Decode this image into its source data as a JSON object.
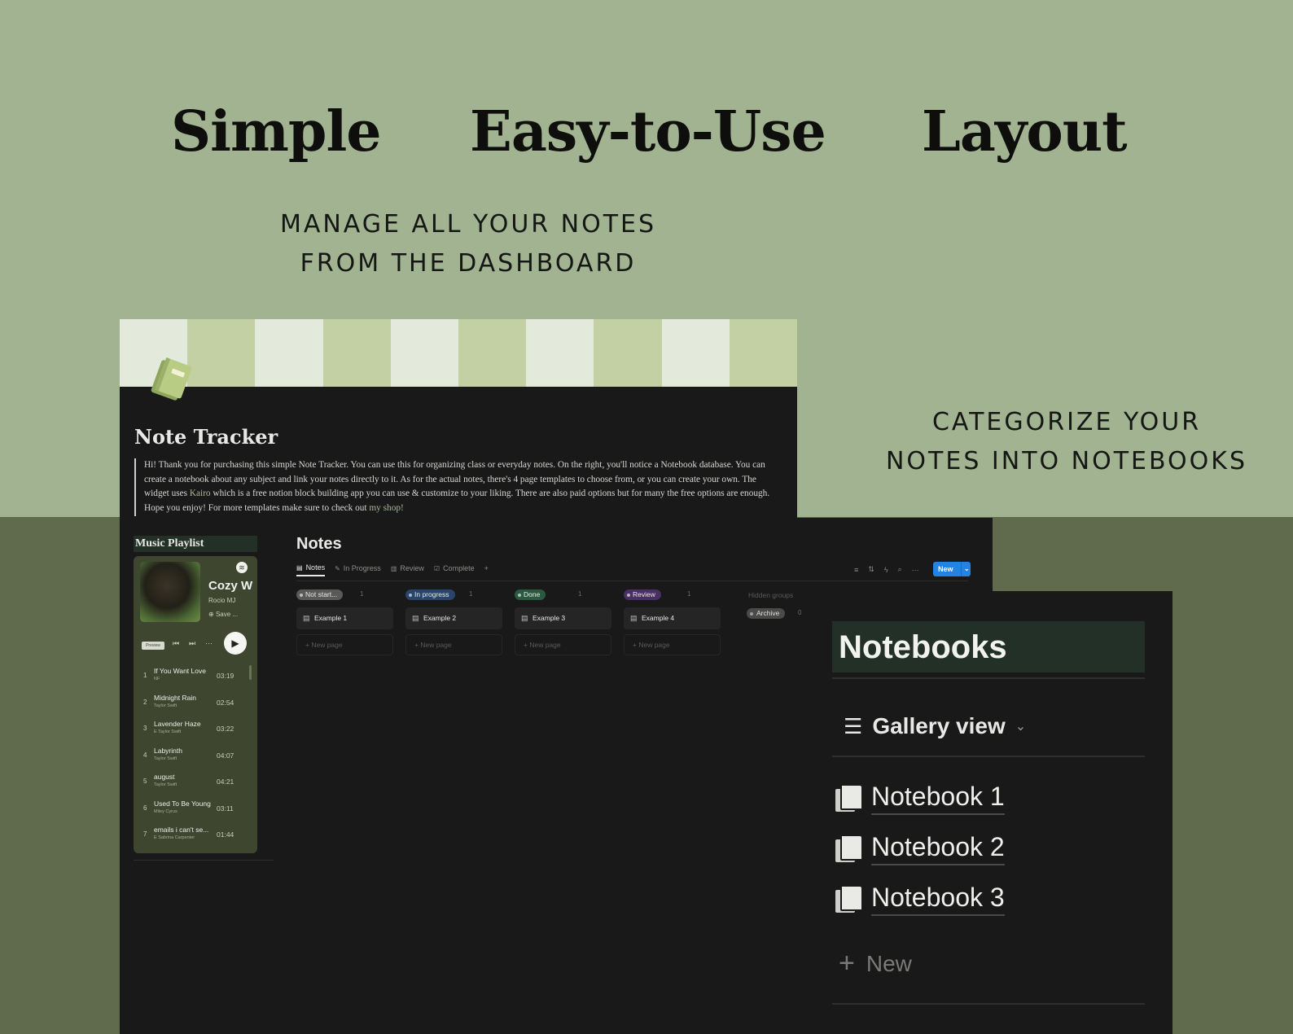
{
  "headlines": [
    "Simple",
    "Easy-to-Use",
    "Layout"
  ],
  "subtitles": {
    "dashboard": [
      "MANAGE ALL YOUR NOTES",
      "FROM THE DASHBOARD"
    ],
    "notebooks": [
      "CATEGORIZE YOUR",
      "NOTES INTO NOTEBOOKS"
    ]
  },
  "colors": {
    "background_top": "#a1b390",
    "background_bottom": "#606a4d",
    "app_background": "#191919",
    "heading_highlight": "#223027",
    "new_button": "#2383e2"
  },
  "page": {
    "title": "Note Tracker",
    "icon": "notebook-icon",
    "intro": {
      "before_kairo": "Hi! Thank you for purchasing this simple Note Tracker. You can use this for organizing class or everyday notes. On the right, you'll notice a Notebook database. You can create a notebook about any subject and link your notes directly to it. As for the actual notes, there's 4 page templates to choose from, or you can create your own. The widget uses ",
      "kairo_link": "Kairo",
      "after_kairo": " which is a free notion block building app you can use & customize to your liking. There are also paid options but for many the free options are enough. Hope you enjoy! For more templates make sure to check out ",
      "shop_link": "my shop!"
    }
  },
  "playlist": {
    "header": "Music Playlist",
    "album_title": "Cozy W",
    "artist": "Rocio MJ",
    "save_label": "Save ...",
    "preview_label": "Preview",
    "controls": {
      "prev": "⏮",
      "next": "⏭",
      "more": "···",
      "play": "▶"
    },
    "tracks": [
      {
        "num": "1",
        "name": "If You Want Love",
        "artist": "NF",
        "time": "03:19"
      },
      {
        "num": "2",
        "name": "Midnight Rain",
        "artist": "Taylor Swift",
        "time": "02:54"
      },
      {
        "num": "3",
        "name": "Lavender Haze",
        "artist": "E Taylor Swift",
        "time": "03:22"
      },
      {
        "num": "4",
        "name": "Labyrinth",
        "artist": "Taylor Swift",
        "time": "04:07"
      },
      {
        "num": "5",
        "name": "august",
        "artist": "Taylor Swift",
        "time": "04:21"
      },
      {
        "num": "6",
        "name": "Used To Be Young",
        "artist": "Miley Cyrus",
        "time": "03:11"
      },
      {
        "num": "7",
        "name": "emails i can't se...",
        "artist": "E Sabrina Carpenter",
        "time": "01:44"
      }
    ]
  },
  "notes": {
    "title": "Notes",
    "tabs": [
      {
        "label": "Notes",
        "icon": "document-icon",
        "glyph": "▤"
      },
      {
        "label": "In Progress",
        "icon": "edit-list-icon",
        "glyph": "✎"
      },
      {
        "label": "Review",
        "icon": "book-icon",
        "glyph": "▥"
      },
      {
        "label": "Complete",
        "icon": "checkbox-icon",
        "glyph": "☑"
      },
      {
        "label": "+",
        "icon": "add-view-icon",
        "glyph": ""
      }
    ],
    "toolbar_icons": [
      "filter-icon",
      "sort-icon",
      "automation-icon",
      "search-icon",
      "more-icon"
    ],
    "toolbar_glyphs": [
      "≡",
      "⇅",
      "ϟ",
      "⌕",
      "···"
    ],
    "new_button": {
      "label": "New",
      "chevron": "⌄"
    },
    "columns": [
      {
        "status": "Not start...",
        "count": "1",
        "card": "Example 1",
        "color": "#5a5a58"
      },
      {
        "status": "In progress",
        "count": "1",
        "card": "Example 2",
        "color": "#28456c"
      },
      {
        "status": "Done",
        "count": "1",
        "card": "Example 3",
        "color": "#2b593f"
      },
      {
        "status": "Review",
        "count": "1",
        "card": "Example 4",
        "color": "#492f64"
      }
    ],
    "new_page_label": "+ New page",
    "hidden_groups_label": "Hidden groups",
    "archive": {
      "label": "Archive",
      "count": "0"
    }
  },
  "notebooks": {
    "title": "Notebooks",
    "view_label": "Gallery view",
    "view_icon": "☰",
    "view_chevron": "⌄",
    "items": [
      "Notebook 1",
      "Notebook 2",
      "Notebook 3"
    ],
    "new_label": "New",
    "new_plus": "+"
  }
}
